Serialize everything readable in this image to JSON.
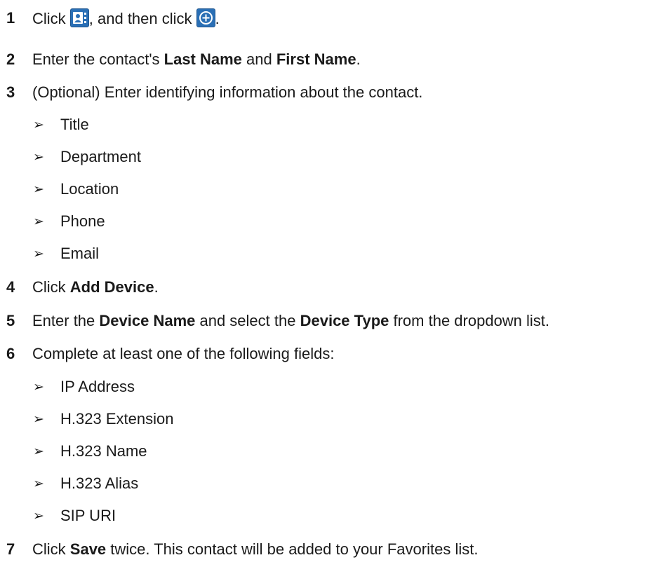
{
  "steps": [
    {
      "num": "1",
      "pre": "Click ",
      "mid": ", and then click ",
      "post": "."
    },
    {
      "num": "2",
      "pre": "Enter the contact's ",
      "b1": "Last Name",
      "mid": " and ",
      "b2": "First Name",
      "post": "."
    },
    {
      "num": "3",
      "text": "(Optional) Enter identifying information about the contact."
    },
    {
      "num": "4",
      "pre": "Click ",
      "b1": "Add Device",
      "post": "."
    },
    {
      "num": "5",
      "pre": "Enter the ",
      "b1": "Device Name",
      "mid": " and select the ",
      "b2": "Device Type",
      "post": " from the dropdown list."
    },
    {
      "num": "6",
      "text": "Complete at least one of the following fields:"
    },
    {
      "num": "7",
      "pre": "Click ",
      "b1": "Save",
      "post": " twice. This contact will be added to your Favorites list."
    }
  ],
  "bullet_glyph": "➢",
  "identifying_fields": [
    "Title",
    "Department",
    "Location",
    "Phone",
    "Email"
  ],
  "device_fields": [
    "IP Address",
    "H.323 Extension",
    "H.323 Name",
    "H.323 Alias",
    "SIP URI"
  ],
  "icons": {
    "contacts": "contacts-icon",
    "add": "add-circle-icon"
  },
  "colors": {
    "icon_bg": "#2a6fb5"
  }
}
